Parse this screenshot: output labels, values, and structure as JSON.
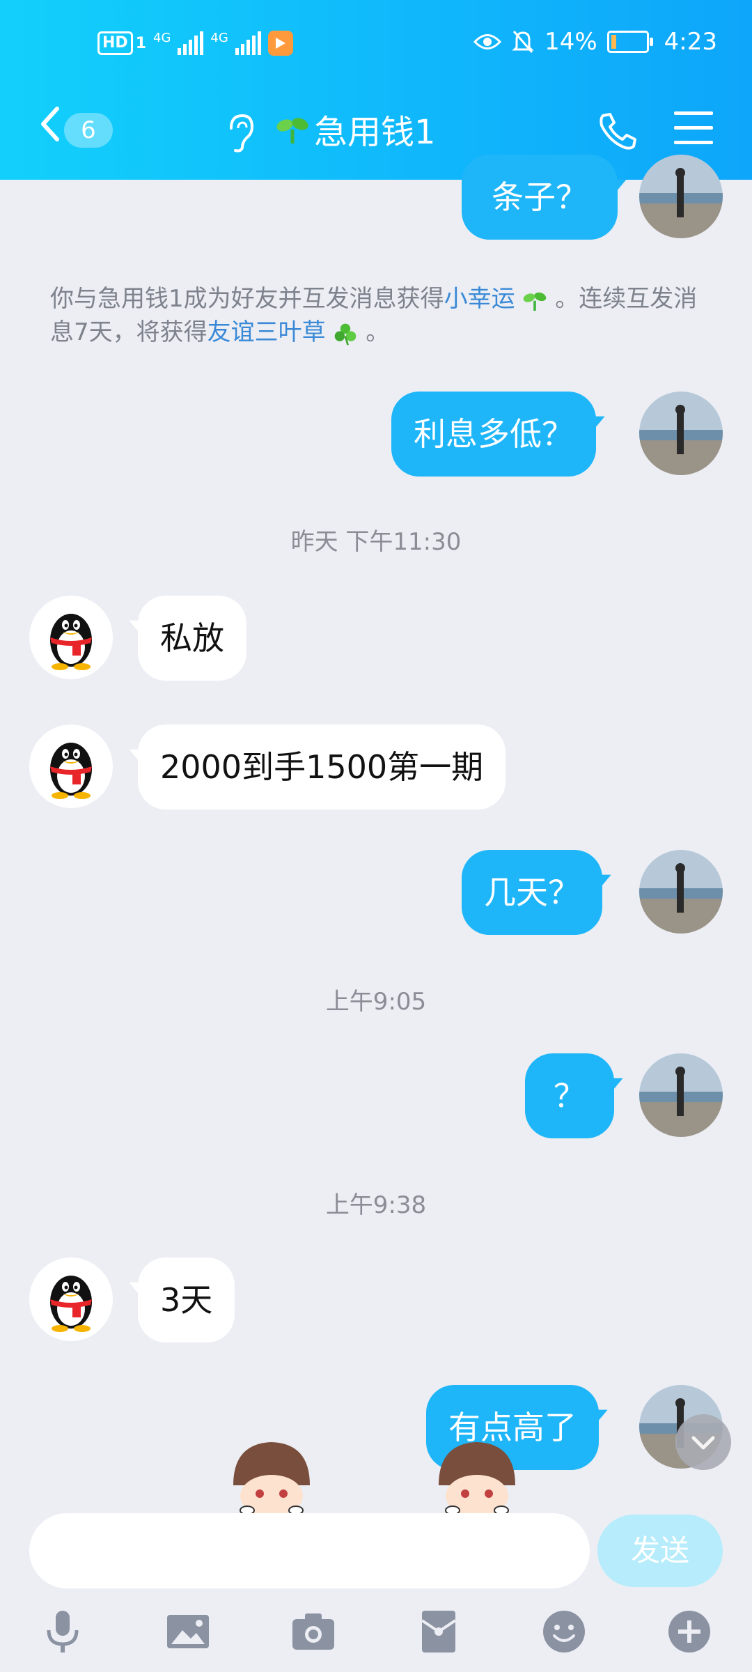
{
  "status_bar": {
    "left_label": "HD",
    "left_sub": "1",
    "signal1_label": "4G",
    "signal2_label": "4G",
    "battery_text": "14%",
    "time": "4:23"
  },
  "navbar": {
    "unread_count": "6",
    "title": "急用钱1"
  },
  "messages": {
    "m0": "条子？",
    "notice_part1": "你与急用钱1成为好友并互发消息获得",
    "notice_link1": "小幸运",
    "notice_part2": "。连续互发消息7天，将获得",
    "notice_link2": "友谊三叶草",
    "notice_part3": "。",
    "m1": "利息多低？",
    "t1": "昨天 下午11:30",
    "m2": "私放",
    "m3": "2000到手1500第一期",
    "m4": "几天？",
    "t2": "上午9:05",
    "m5": "？",
    "t3": "上午9:38",
    "m6": "3天",
    "m7": "有点高了"
  },
  "input": {
    "placeholder": "",
    "send_label": "发送"
  },
  "colors": {
    "header_start": "#12d0fb",
    "header_end": "#0ea6fa",
    "outgoing_bubble": "#1eb6f8",
    "incoming_bubble": "#ffffff",
    "link": "#3a89d6"
  }
}
